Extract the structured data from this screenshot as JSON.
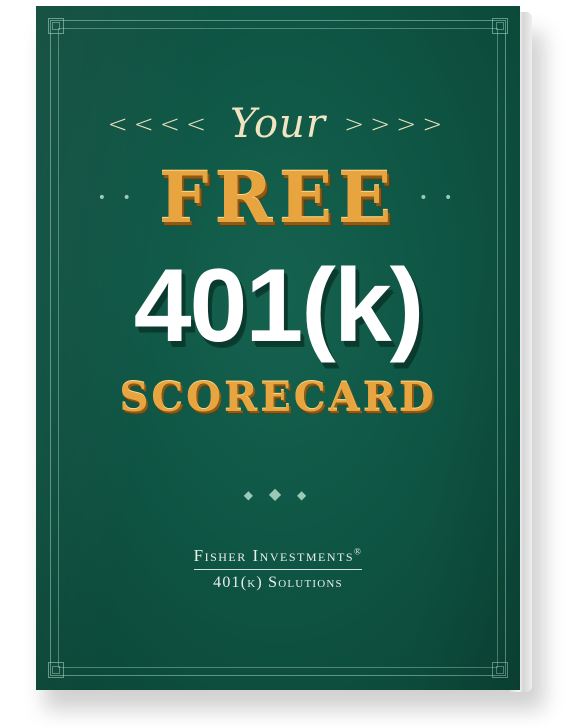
{
  "cover": {
    "chevrons_left": "<<<<",
    "chevrons_right": ">>>>",
    "your": "Your",
    "free": "FREE",
    "title": "401(k)",
    "subtitle": "SCORECARD",
    "brand_name": "Fisher Investments",
    "brand_mark": "®",
    "brand_sub": "401(k) Solutions"
  },
  "colors": {
    "cover_green": "#0f5645",
    "gold": "#e8a43f",
    "cream": "#f1e4c3",
    "white": "#ffffff"
  }
}
